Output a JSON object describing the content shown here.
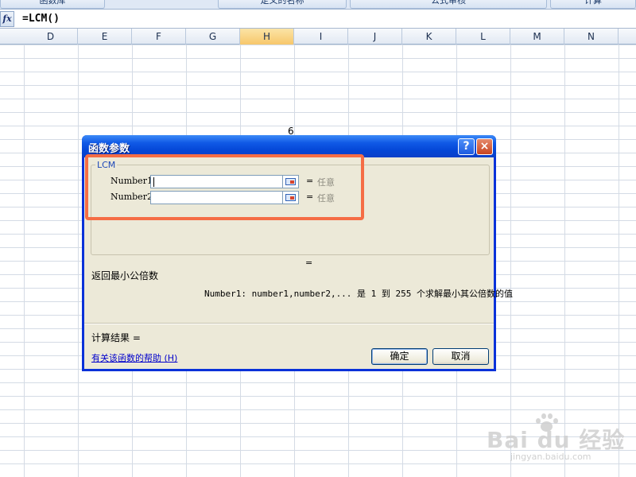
{
  "ribbon": {
    "buttons": [
      "函数库",
      "定义的名称",
      "公式审核",
      "计算"
    ]
  },
  "formula_bar": {
    "fx_icon": "fx",
    "formula": "=LCM()"
  },
  "sheet": {
    "columns": [
      "D",
      "E",
      "F",
      "G",
      "H",
      "I",
      "J",
      "K",
      "L",
      "M",
      "N"
    ],
    "active_column": "H",
    "cell_value": "6"
  },
  "dialog": {
    "title": "函数参数",
    "help_button": "?",
    "close_button": "×",
    "function_name": "LCM",
    "args": [
      {
        "label": "Number1",
        "value": "",
        "equals": "=",
        "type_hint": "任意"
      },
      {
        "label": "Number2",
        "value": "",
        "equals": "=",
        "type_hint": "任意"
      }
    ],
    "result_equals": "=",
    "description": "返回最小公倍数",
    "arg_description": "Number1:  number1,number2,... 是 1 到 255 个求解最小其公倍数的值",
    "calc_result": "计算结果 =",
    "help_link": "有关该函数的帮助 (H)",
    "ok_label": "确定",
    "cancel_label": "取消",
    "highlight_color": "#f56d45"
  },
  "watermark": {
    "brand": "Bai du 经验",
    "url": "jingyan.baidu.com"
  }
}
